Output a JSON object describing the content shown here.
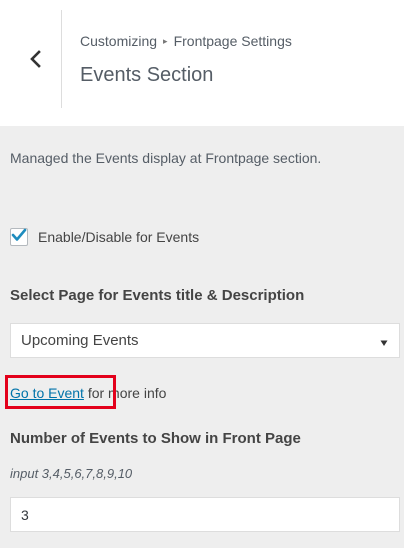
{
  "header": {
    "breadcrumb_root": "Customizing",
    "breadcrumb_separator": "▸",
    "breadcrumb_parent": "Frontpage Settings",
    "title": "Events Section",
    "back_icon": "chevron-left-icon"
  },
  "section": {
    "description": "Managed the Events display at Frontpage section.",
    "enable_checkbox": {
      "label": "Enable/Disable for Events",
      "checked": true,
      "check_color": "#1e8cbe"
    },
    "page_select": {
      "label": "Select Page for Events title & Description",
      "value": "Upcoming Events"
    },
    "info": {
      "link_text": "Go to Event",
      "suffix": " for more info",
      "highlight_color": "#e3001b"
    },
    "number_field": {
      "label": "Number of Events to Show in Front Page",
      "hint": "input 3,4,5,6,7,8,9,10",
      "value": "3"
    }
  }
}
